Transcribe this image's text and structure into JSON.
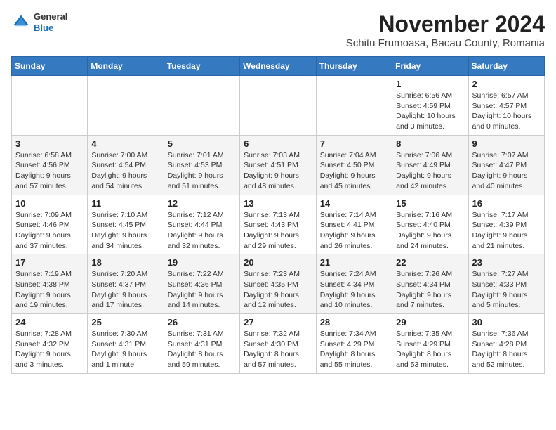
{
  "header": {
    "logo": {
      "line1": "General",
      "line2": "Blue"
    },
    "title": "November 2024",
    "subtitle": "Schitu Frumoasa, Bacau County, Romania"
  },
  "weekdays": [
    "Sunday",
    "Monday",
    "Tuesday",
    "Wednesday",
    "Thursday",
    "Friday",
    "Saturday"
  ],
  "weeks": [
    [
      {
        "day": "",
        "info": ""
      },
      {
        "day": "",
        "info": ""
      },
      {
        "day": "",
        "info": ""
      },
      {
        "day": "",
        "info": ""
      },
      {
        "day": "",
        "info": ""
      },
      {
        "day": "1",
        "info": "Sunrise: 6:56 AM\nSunset: 4:59 PM\nDaylight: 10 hours\nand 3 minutes."
      },
      {
        "day": "2",
        "info": "Sunrise: 6:57 AM\nSunset: 4:57 PM\nDaylight: 10 hours\nand 0 minutes."
      }
    ],
    [
      {
        "day": "3",
        "info": "Sunrise: 6:58 AM\nSunset: 4:56 PM\nDaylight: 9 hours\nand 57 minutes."
      },
      {
        "day": "4",
        "info": "Sunrise: 7:00 AM\nSunset: 4:54 PM\nDaylight: 9 hours\nand 54 minutes."
      },
      {
        "day": "5",
        "info": "Sunrise: 7:01 AM\nSunset: 4:53 PM\nDaylight: 9 hours\nand 51 minutes."
      },
      {
        "day": "6",
        "info": "Sunrise: 7:03 AM\nSunset: 4:51 PM\nDaylight: 9 hours\nand 48 minutes."
      },
      {
        "day": "7",
        "info": "Sunrise: 7:04 AM\nSunset: 4:50 PM\nDaylight: 9 hours\nand 45 minutes."
      },
      {
        "day": "8",
        "info": "Sunrise: 7:06 AM\nSunset: 4:49 PM\nDaylight: 9 hours\nand 42 minutes."
      },
      {
        "day": "9",
        "info": "Sunrise: 7:07 AM\nSunset: 4:47 PM\nDaylight: 9 hours\nand 40 minutes."
      }
    ],
    [
      {
        "day": "10",
        "info": "Sunrise: 7:09 AM\nSunset: 4:46 PM\nDaylight: 9 hours\nand 37 minutes."
      },
      {
        "day": "11",
        "info": "Sunrise: 7:10 AM\nSunset: 4:45 PM\nDaylight: 9 hours\nand 34 minutes."
      },
      {
        "day": "12",
        "info": "Sunrise: 7:12 AM\nSunset: 4:44 PM\nDaylight: 9 hours\nand 32 minutes."
      },
      {
        "day": "13",
        "info": "Sunrise: 7:13 AM\nSunset: 4:43 PM\nDaylight: 9 hours\nand 29 minutes."
      },
      {
        "day": "14",
        "info": "Sunrise: 7:14 AM\nSunset: 4:41 PM\nDaylight: 9 hours\nand 26 minutes."
      },
      {
        "day": "15",
        "info": "Sunrise: 7:16 AM\nSunset: 4:40 PM\nDaylight: 9 hours\nand 24 minutes."
      },
      {
        "day": "16",
        "info": "Sunrise: 7:17 AM\nSunset: 4:39 PM\nDaylight: 9 hours\nand 21 minutes."
      }
    ],
    [
      {
        "day": "17",
        "info": "Sunrise: 7:19 AM\nSunset: 4:38 PM\nDaylight: 9 hours\nand 19 minutes."
      },
      {
        "day": "18",
        "info": "Sunrise: 7:20 AM\nSunset: 4:37 PM\nDaylight: 9 hours\nand 17 minutes."
      },
      {
        "day": "19",
        "info": "Sunrise: 7:22 AM\nSunset: 4:36 PM\nDaylight: 9 hours\nand 14 minutes."
      },
      {
        "day": "20",
        "info": "Sunrise: 7:23 AM\nSunset: 4:35 PM\nDaylight: 9 hours\nand 12 minutes."
      },
      {
        "day": "21",
        "info": "Sunrise: 7:24 AM\nSunset: 4:34 PM\nDaylight: 9 hours\nand 10 minutes."
      },
      {
        "day": "22",
        "info": "Sunrise: 7:26 AM\nSunset: 4:34 PM\nDaylight: 9 hours\nand 7 minutes."
      },
      {
        "day": "23",
        "info": "Sunrise: 7:27 AM\nSunset: 4:33 PM\nDaylight: 9 hours\nand 5 minutes."
      }
    ],
    [
      {
        "day": "24",
        "info": "Sunrise: 7:28 AM\nSunset: 4:32 PM\nDaylight: 9 hours\nand 3 minutes."
      },
      {
        "day": "25",
        "info": "Sunrise: 7:30 AM\nSunset: 4:31 PM\nDaylight: 9 hours\nand 1 minute."
      },
      {
        "day": "26",
        "info": "Sunrise: 7:31 AM\nSunset: 4:31 PM\nDaylight: 8 hours\nand 59 minutes."
      },
      {
        "day": "27",
        "info": "Sunrise: 7:32 AM\nSunset: 4:30 PM\nDaylight: 8 hours\nand 57 minutes."
      },
      {
        "day": "28",
        "info": "Sunrise: 7:34 AM\nSunset: 4:29 PM\nDaylight: 8 hours\nand 55 minutes."
      },
      {
        "day": "29",
        "info": "Sunrise: 7:35 AM\nSunset: 4:29 PM\nDaylight: 8 hours\nand 53 minutes."
      },
      {
        "day": "30",
        "info": "Sunrise: 7:36 AM\nSunset: 4:28 PM\nDaylight: 8 hours\nand 52 minutes."
      }
    ]
  ]
}
